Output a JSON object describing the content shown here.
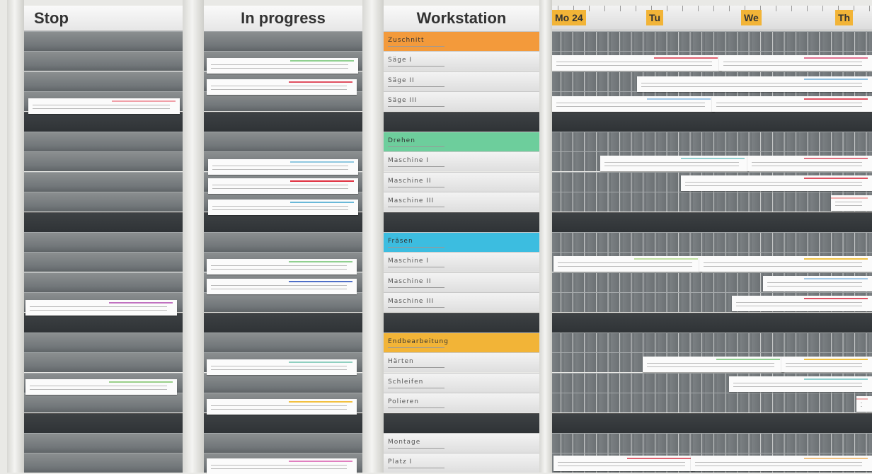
{
  "columns": {
    "stop": {
      "title": "Stop"
    },
    "progress": {
      "title": "In progress"
    },
    "workstation": {
      "title": "Workstation"
    }
  },
  "workstation_rows": [
    {
      "label": "Zuschnitt",
      "color": "#f39a3b",
      "kind": "group"
    },
    {
      "label": "Säge I",
      "kind": "item"
    },
    {
      "label": "Säge II",
      "kind": "item"
    },
    {
      "label": "Säge III",
      "kind": "item"
    },
    {
      "label": "",
      "kind": "dark"
    },
    {
      "label": "Drehen",
      "color": "#6dce9c",
      "kind": "group"
    },
    {
      "label": "Maschine I",
      "kind": "item"
    },
    {
      "label": "Maschine II",
      "kind": "item"
    },
    {
      "label": "Maschine III",
      "kind": "item"
    },
    {
      "label": "",
      "kind": "dark"
    },
    {
      "label": "Fräsen",
      "color": "#3cbde0",
      "kind": "group"
    },
    {
      "label": "Maschine I",
      "kind": "item"
    },
    {
      "label": "Maschine II",
      "kind": "item"
    },
    {
      "label": "Maschine III",
      "kind": "item"
    },
    {
      "label": "",
      "kind": "dark"
    },
    {
      "label": "Endbearbeitung",
      "color": "#f2b437",
      "kind": "group"
    },
    {
      "label": "Härten",
      "kind": "item"
    },
    {
      "label": "Schleifen",
      "kind": "item"
    },
    {
      "label": "Polieren",
      "kind": "item"
    },
    {
      "label": "",
      "kind": "dark"
    },
    {
      "label": "Montage",
      "kind": "item"
    },
    {
      "label": "Platz I",
      "kind": "item"
    }
  ],
  "days": [
    {
      "label": "Mo 24"
    },
    {
      "label": "Tu"
    },
    {
      "label": "We"
    },
    {
      "label": "Th"
    }
  ],
  "colors": {
    "accent_orange": "#f39a3b",
    "accent_green": "#6dce9c",
    "accent_blue": "#3cbde0",
    "accent_yellow": "#f2b437"
  }
}
